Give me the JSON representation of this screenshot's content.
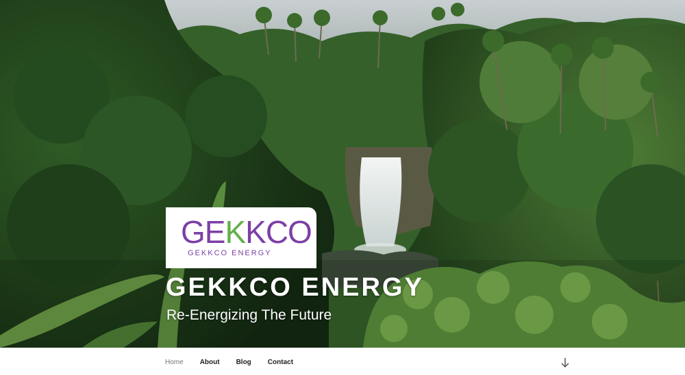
{
  "site": {
    "logo_mark_left": "GE",
    "logo_mark_green": "K",
    "logo_mark_right": "KCO",
    "logo_subtitle": "GEKKCO ENERGY",
    "title": "GEKKCO ENERGY",
    "tagline": "Re-Energizing The Future"
  },
  "hero": {
    "image_subject": "jungle-waterfall-photo"
  },
  "nav": {
    "items": [
      {
        "label": "Home",
        "current": true
      },
      {
        "label": "About",
        "current": false
      },
      {
        "label": "Blog",
        "current": false
      },
      {
        "label": "Contact",
        "current": false
      }
    ],
    "scroll_icon": "arrow-down-icon"
  },
  "colors": {
    "brand_purple": "#7c3fa6",
    "brand_green": "#62b04a",
    "nav_text": "#222222",
    "nav_current": "#767676"
  }
}
